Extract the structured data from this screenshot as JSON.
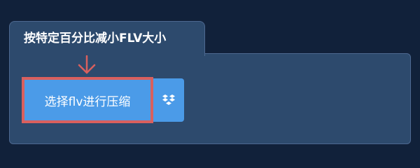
{
  "panel": {
    "title": "按特定百分比减小FLV大小"
  },
  "actions": {
    "select_file_label": "选择flv进行压缩",
    "dropbox_icon": "dropbox-icon"
  },
  "annotation": {
    "arrow_icon": "arrow-down-icon"
  },
  "colors": {
    "background": "#11213a",
    "panel": "#2d4a6d",
    "panel_border": "#4d6890",
    "button": "#4b9be8",
    "highlight": "#d9605e",
    "text": "#ffffff"
  }
}
